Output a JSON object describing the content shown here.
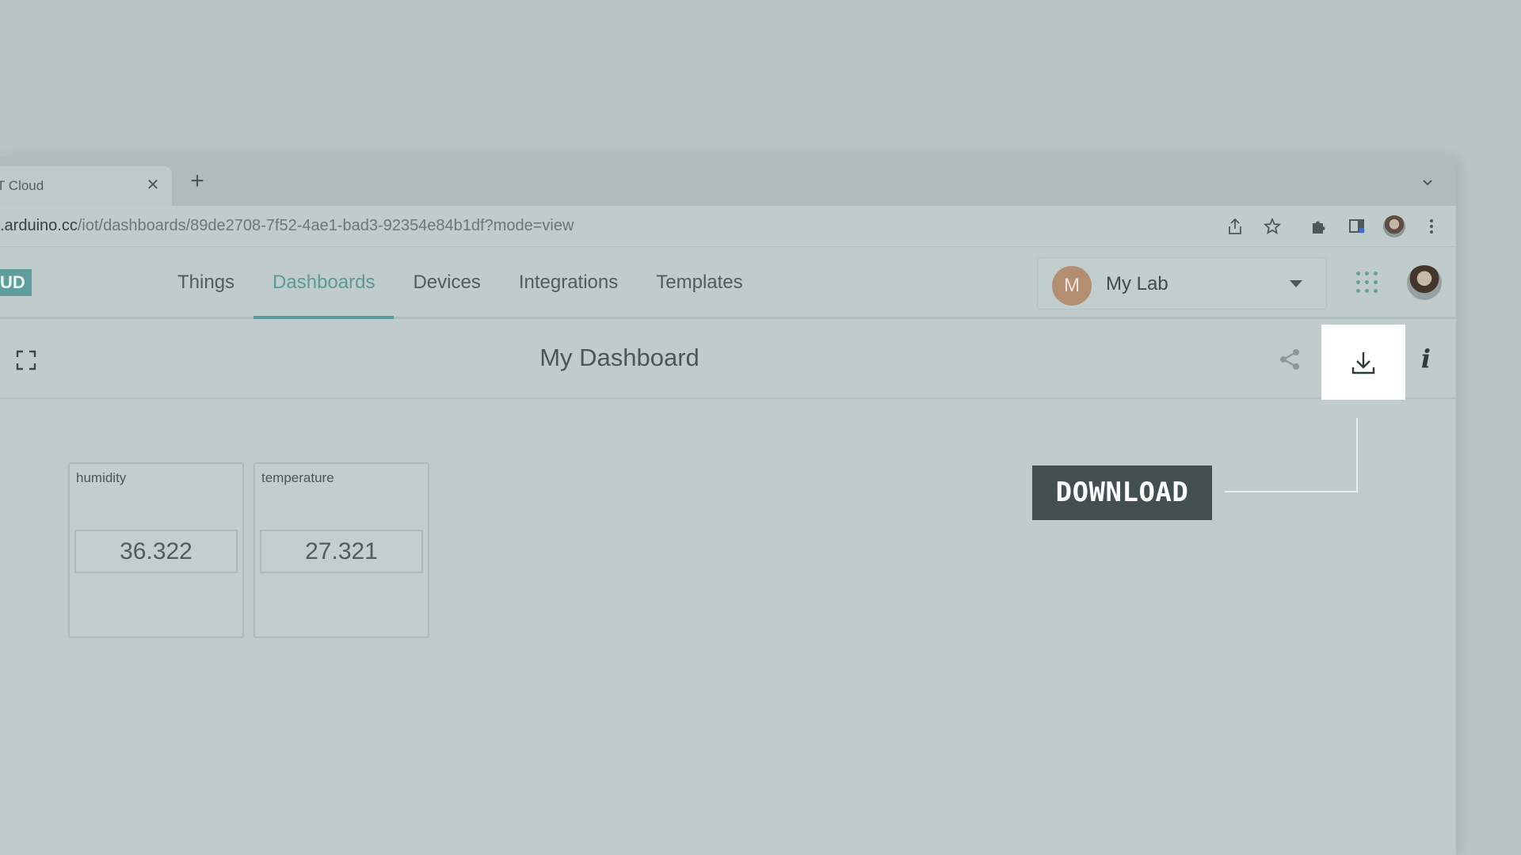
{
  "browser": {
    "tab_title": "T Cloud",
    "tab_close": "✕",
    "new_tab": "+",
    "url_host": ".arduino.cc",
    "url_path": "/iot/dashboards/89de2708-7f52-4ae1-bad3-92354e84b1df?mode=view"
  },
  "app": {
    "logo_text": "UD",
    "nav": [
      {
        "label": "Things",
        "active": false
      },
      {
        "label": "Dashboards",
        "active": true
      },
      {
        "label": "Devices",
        "active": false
      },
      {
        "label": "Integrations",
        "active": false
      },
      {
        "label": "Templates",
        "active": false
      }
    ],
    "space": {
      "initial": "M",
      "name": "My Lab"
    }
  },
  "dashboard": {
    "title": "My Dashboard",
    "info_glyph": "i"
  },
  "widgets": [
    {
      "label": "humidity",
      "value": "36.322"
    },
    {
      "label": "temperature",
      "value": "27.321"
    }
  ],
  "callout": {
    "label": "DOWNLOAD"
  },
  "colors": {
    "accent": "#5e9898",
    "overlay_bg": "#c0cbcb",
    "callout_bg": "#434f51"
  }
}
